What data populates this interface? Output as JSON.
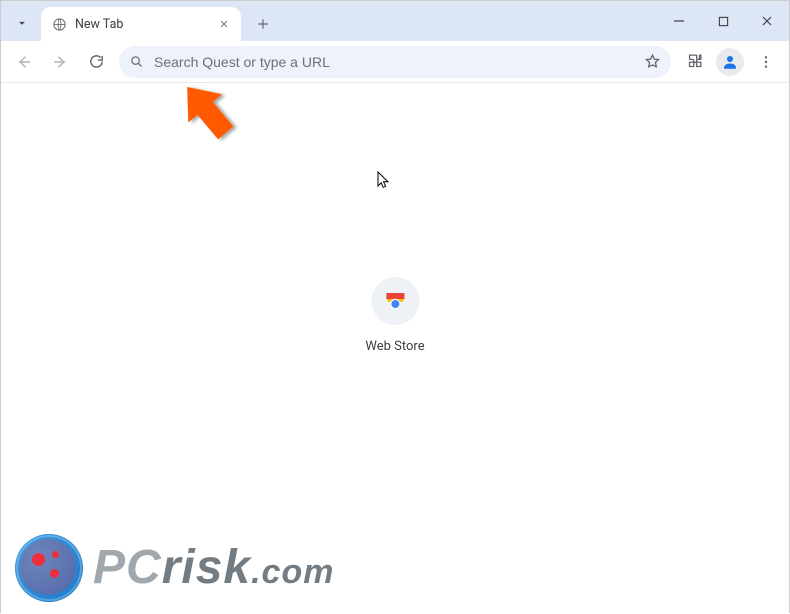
{
  "window": {
    "minimize_tooltip": "Minimize",
    "maximize_tooltip": "Maximize",
    "close_tooltip": "Close"
  },
  "tab": {
    "title": "New Tab"
  },
  "toolbar": {
    "back_tooltip": "Back",
    "forward_tooltip": "Forward",
    "reload_tooltip": "Reload",
    "bookmark_tooltip": "Bookmark this tab",
    "extensions_tooltip": "Extensions",
    "profile_tooltip": "Profile",
    "menu_tooltip": "Customize and control"
  },
  "omnibox": {
    "placeholder": "Search Quest or type a URL",
    "value": ""
  },
  "shortcut": {
    "label": "Web Store"
  },
  "watermark": {
    "brand_prefix": "PC",
    "brand_suffix": "risk",
    "tld": ".com"
  }
}
